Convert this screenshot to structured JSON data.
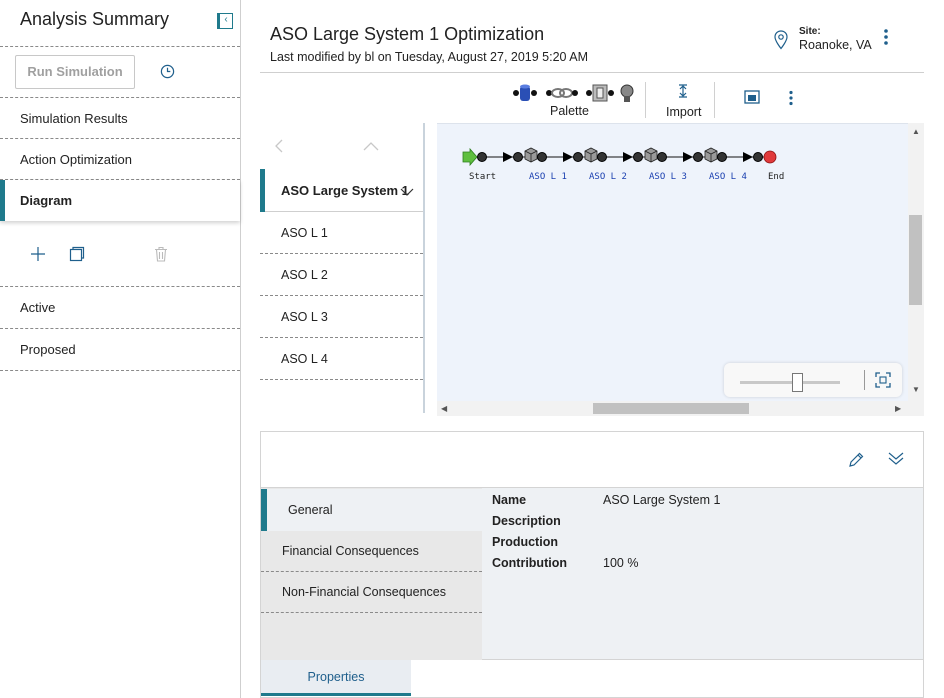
{
  "left_panel": {
    "title": "Analysis Summary",
    "run_simulation": "Run Simulation",
    "nav": {
      "simulation_results": "Simulation Results",
      "action_optimization": "Action Optimization",
      "diagram": "Diagram",
      "active": "Active",
      "proposed": "Proposed"
    }
  },
  "header": {
    "title": "ASO Large System 1 Optimization",
    "subtitle": "Last modified by bl on Tuesday, August 27, 2019 5:20 AM",
    "site_label": "Site:",
    "site_value": "Roanoke, VA"
  },
  "toolbar": {
    "palette": "Palette",
    "import": "Import"
  },
  "tree": {
    "root": "ASO Large System 1",
    "items": [
      "ASO L 1",
      "ASO L 2",
      "ASO L 3",
      "ASO L 4"
    ]
  },
  "diagram": {
    "labels": [
      "Start",
      "ASO L 1",
      "ASO L 2",
      "ASO L 3",
      "ASO L 4",
      "End"
    ],
    "zoom_level": 0.58
  },
  "details": {
    "tabs": [
      "General",
      "Financial Consequences",
      "Non-Financial Consequences"
    ],
    "properties": [
      {
        "name": "Name",
        "value": "ASO Large System 1"
      },
      {
        "name": "Description",
        "value": ""
      },
      {
        "name": "Production",
        "value": ""
      },
      {
        "name": "Contribution",
        "value": "100 %"
      }
    ],
    "bottom_tab": "Properties"
  },
  "colors": {
    "accent": "#1f7a8c",
    "canvas_bg": "#eef3fb",
    "start_node": "#5fbf3f",
    "end_node": "#e0393b"
  }
}
